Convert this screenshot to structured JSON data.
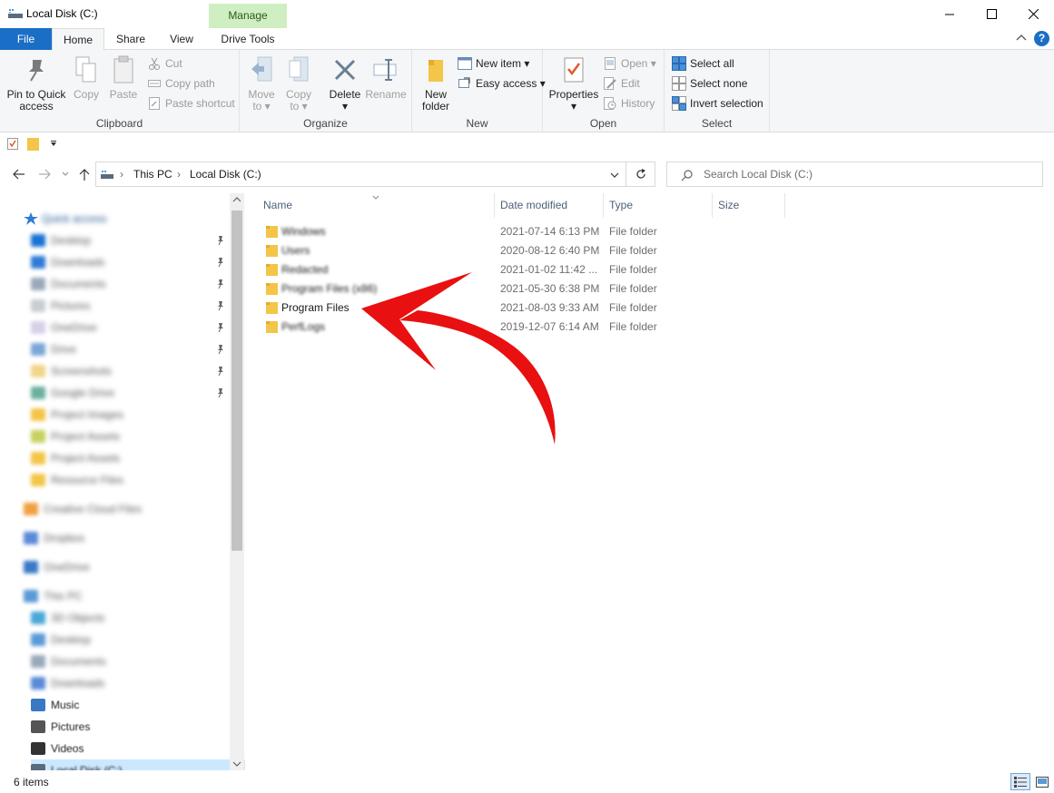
{
  "window": {
    "title": "Local Disk (C:)",
    "manage_label": "Manage",
    "icons": {
      "minimize": "minimize-icon",
      "maximize": "maximize-icon",
      "close": "close-icon"
    }
  },
  "tabs": {
    "file": "File",
    "home": "Home",
    "share": "Share",
    "view": "View",
    "drive_tools": "Drive Tools"
  },
  "ribbon": {
    "clipboard": {
      "label": "Clipboard",
      "pin_line1": "Pin to Quick",
      "pin_line2": "access",
      "copy": "Copy",
      "paste": "Paste",
      "cut": "Cut",
      "copy_path": "Copy path",
      "paste_shortcut": "Paste shortcut"
    },
    "organize": {
      "label": "Organize",
      "move_line1": "Move",
      "move_line2": "to",
      "copy_line1": "Copy",
      "copy_line2": "to",
      "delete": "Delete",
      "rename": "Rename"
    },
    "new": {
      "label": "New",
      "folder_line1": "New",
      "folder_line2": "folder",
      "new_item": "New item",
      "easy_access": "Easy access"
    },
    "open": {
      "label": "Open",
      "properties": "Properties",
      "open": "Open",
      "edit": "Edit",
      "history": "History"
    },
    "select": {
      "label": "Select",
      "select_all": "Select all",
      "select_none": "Select none",
      "invert": "Invert selection"
    }
  },
  "address": {
    "crumbs": [
      "This PC",
      "Local Disk (C:)"
    ],
    "search_placeholder": "Search Local Disk (C:)"
  },
  "nav": {
    "quick_access": "Quick access",
    "items": [
      "Desktop",
      "Downloads",
      "Documents",
      "Pictures",
      "OneDrive",
      "Drive",
      "Screenshots",
      "Google Drive",
      "Project Images",
      "Project Assets",
      "Project Assets",
      "Resource Files",
      "Creative Cloud Files",
      "Dropbox",
      "OneDrive",
      "This PC",
      "3D Objects",
      "Desktop",
      "Documents",
      "Downloads",
      "Music",
      "Pictures",
      "Videos",
      "Local Disk (C:)"
    ],
    "visible": {
      "music": "Music",
      "pictures": "Pictures",
      "videos": "Videos",
      "local_disk": "Local Disk (C:)"
    }
  },
  "columns": {
    "name": "Name",
    "date": "Date modified",
    "type": "Type",
    "size": "Size"
  },
  "files": [
    {
      "name": "Windows",
      "date": "2021-07-14 6:13 PM",
      "type": "File folder",
      "blur": true
    },
    {
      "name": "Users",
      "date": "2020-08-12 6:40 PM",
      "type": "File folder",
      "blur": true
    },
    {
      "name": "Redacted",
      "date": "2021-01-02 11:42 ...",
      "type": "File folder",
      "blur": true
    },
    {
      "name": "Program Files (x86)",
      "date": "2021-05-30 6:38 PM",
      "type": "File folder",
      "blur": true
    },
    {
      "name": "Program Files",
      "date": "2021-08-03 9:33 AM",
      "type": "File folder",
      "blur": false
    },
    {
      "name": "PerfLogs",
      "date": "2019-12-07 6:14 AM",
      "type": "File folder",
      "blur": true
    }
  ],
  "status": {
    "items": "6 items"
  },
  "colors": {
    "accent": "#1a6ec6",
    "manage_bg": "#cfeec1",
    "folder": "#f3c548",
    "arrow": "#e81010"
  }
}
